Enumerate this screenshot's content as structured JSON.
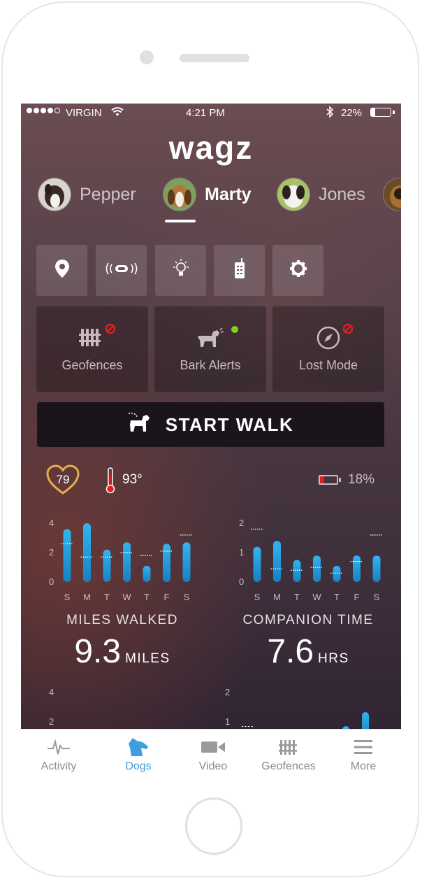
{
  "status_bar": {
    "carrier": "VIRGIN",
    "time": "4:21 PM",
    "battery": "22%"
  },
  "app": {
    "logo": "wagz"
  },
  "dogs": [
    {
      "name": "Pepper",
      "active": false
    },
    {
      "name": "Marty",
      "active": true
    },
    {
      "name": "Jones",
      "active": false
    }
  ],
  "tools": [
    "location-pin-icon",
    "collar-icon",
    "light-bulb-icon",
    "remote-icon",
    "gear-icon"
  ],
  "features": [
    {
      "label": "Geofences",
      "icon": "fence-icon",
      "status": "off",
      "status_color": "#e0201f"
    },
    {
      "label": "Bark Alerts",
      "icon": "barking-dog-icon",
      "status": "on",
      "status_color": "#7ed321"
    },
    {
      "label": "Lost Mode",
      "icon": "compass-icon",
      "status": "off",
      "status_color": "#e0201f"
    }
  ],
  "start_walk": {
    "label": "START WALK"
  },
  "vitals": {
    "heart_rate": "79",
    "temperature": "93°",
    "device_battery": "18%"
  },
  "chart_data": [
    {
      "type": "bar",
      "title": "MILES WALKED",
      "categories": [
        "S",
        "M",
        "T",
        "W",
        "T",
        "F",
        "S"
      ],
      "values": [
        3.6,
        4.0,
        2.2,
        2.7,
        1.1,
        2.6,
        2.7
      ],
      "targets": [
        2.6,
        1.7,
        1.7,
        2.0,
        1.8,
        2.1,
        3.2
      ],
      "ylim": [
        0,
        4
      ],
      "yticks": [
        "0",
        "2",
        "4"
      ],
      "total": "9.3",
      "unit": "MILES"
    },
    {
      "type": "bar",
      "title": "COMPANION TIME",
      "categories": [
        "S",
        "M",
        "T",
        "W",
        "T",
        "F",
        "S"
      ],
      "values": [
        1.2,
        1.4,
        0.75,
        0.9,
        0.55,
        0.9,
        0.9
      ],
      "targets": [
        1.8,
        0.45,
        0.4,
        0.5,
        0.3,
        0.7,
        1.6
      ],
      "ylim": [
        0,
        2
      ],
      "yticks": [
        "0",
        "1",
        "2"
      ],
      "total": "7.6",
      "unit": "HRS"
    }
  ],
  "partial_charts": [
    {
      "yticks": [
        "2",
        "4"
      ]
    },
    {
      "yticks": [
        "1",
        "2"
      ]
    }
  ],
  "tabs": [
    {
      "label": "Activity",
      "icon": "activity-icon",
      "active": false
    },
    {
      "label": "Dogs",
      "icon": "dog-icon",
      "active": true
    },
    {
      "label": "Video",
      "icon": "video-icon",
      "active": false
    },
    {
      "label": "Geofences",
      "icon": "fence-icon",
      "active": false
    },
    {
      "label": "More",
      "icon": "menu-icon",
      "active": false
    }
  ]
}
